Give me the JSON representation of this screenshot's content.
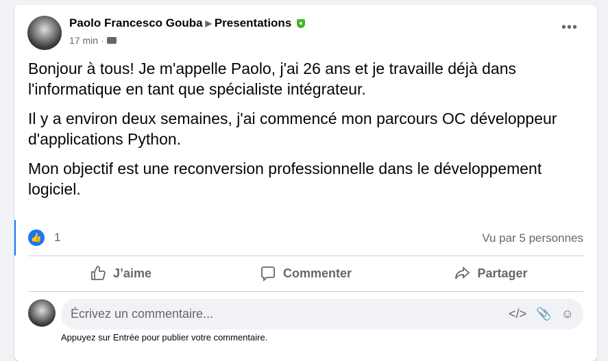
{
  "post": {
    "author": "Paolo Francesco Gouba",
    "group": "Presentations",
    "time": "17 min",
    "separator": "·",
    "paragraphs": [
      "Bonjour à tous! Je m'appelle Paolo, j'ai 26 ans et je travaille déjà dans l'informatique en tant que spécialiste intégrateur.",
      "Il y a environ deux semaines, j'ai commencé mon parcours OC développeur d'applications Python.",
      "Mon objectif est une reconversion professionnelle dans le développement logiciel."
    ]
  },
  "reactions": {
    "count": "1",
    "seen": "Vu par 5 personnes"
  },
  "actions": {
    "like": "J’aime",
    "comment": "Commenter",
    "share": "Partager"
  },
  "comment": {
    "placeholder": "Écrivez un commentaire...",
    "hint": "Appuyez sur Entrée pour publier votre commentaire."
  },
  "colors": {
    "accent": "#1877f2",
    "admin": "#42b72a"
  }
}
